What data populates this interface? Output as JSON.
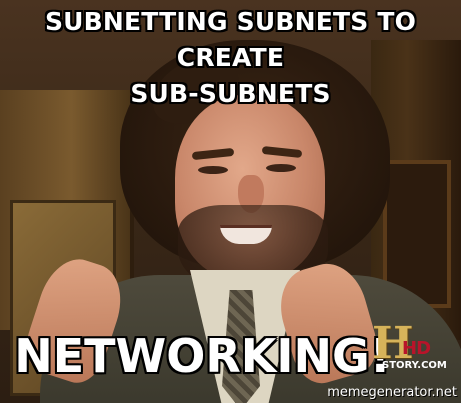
{
  "meme": {
    "top_caption_line1": "SUBNETTING SUBNETS TO CREATE",
    "top_caption_line2": "SUB-SUBNETS",
    "bottom_caption": "NETWORKING!",
    "logo": {
      "letter": "H",
      "badge": "HD",
      "site": "STORY.COM"
    },
    "credit": "memegenerator.net"
  }
}
